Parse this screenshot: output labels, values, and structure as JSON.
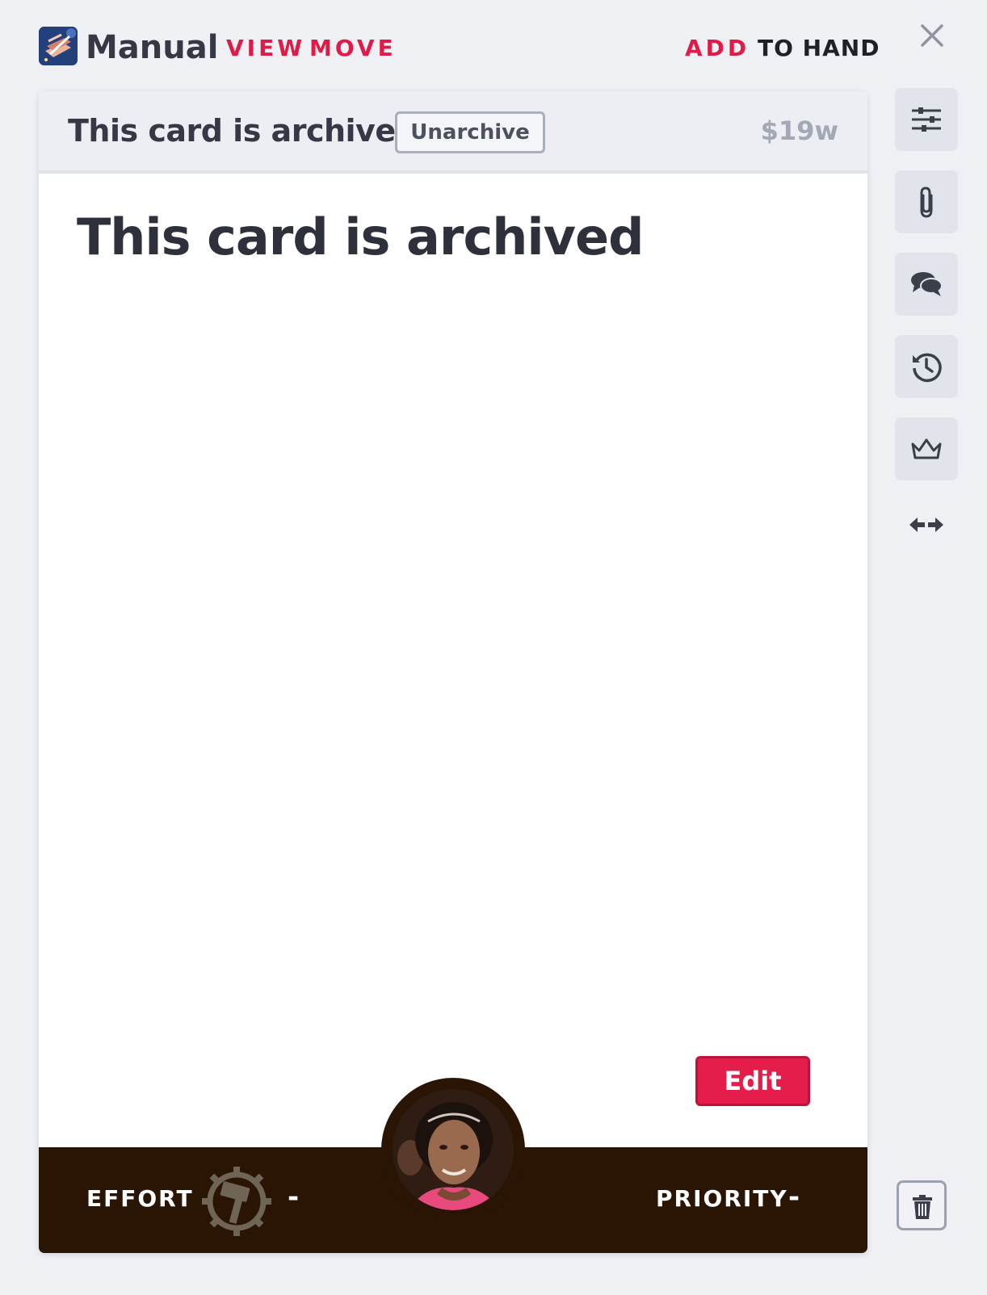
{
  "header": {
    "deck_title": "Manual",
    "nav": [
      "VIEW",
      "MOVE"
    ],
    "add_label": "ADD",
    "to_hand_label": "TO HAND"
  },
  "banner": {
    "archived_text": "This card is archived.",
    "unarchive_label": "Unarchive",
    "cost": "$19w"
  },
  "card": {
    "title": "This card is archived",
    "edit_label": "Edit"
  },
  "footer": {
    "effort_label": "EFFORT",
    "effort_value": "-",
    "priority_label": "PRIORITY",
    "priority_value": "-"
  },
  "sidebar": {
    "icons": [
      "sliders-icon",
      "paperclip-icon",
      "comments-icon",
      "history-icon",
      "crown-icon",
      "expand-arrows-icon",
      "trash-icon"
    ]
  },
  "colors": {
    "accent": "#e01b48",
    "footer_bg": "#2a1505",
    "page_bg": "#eef0f4"
  }
}
